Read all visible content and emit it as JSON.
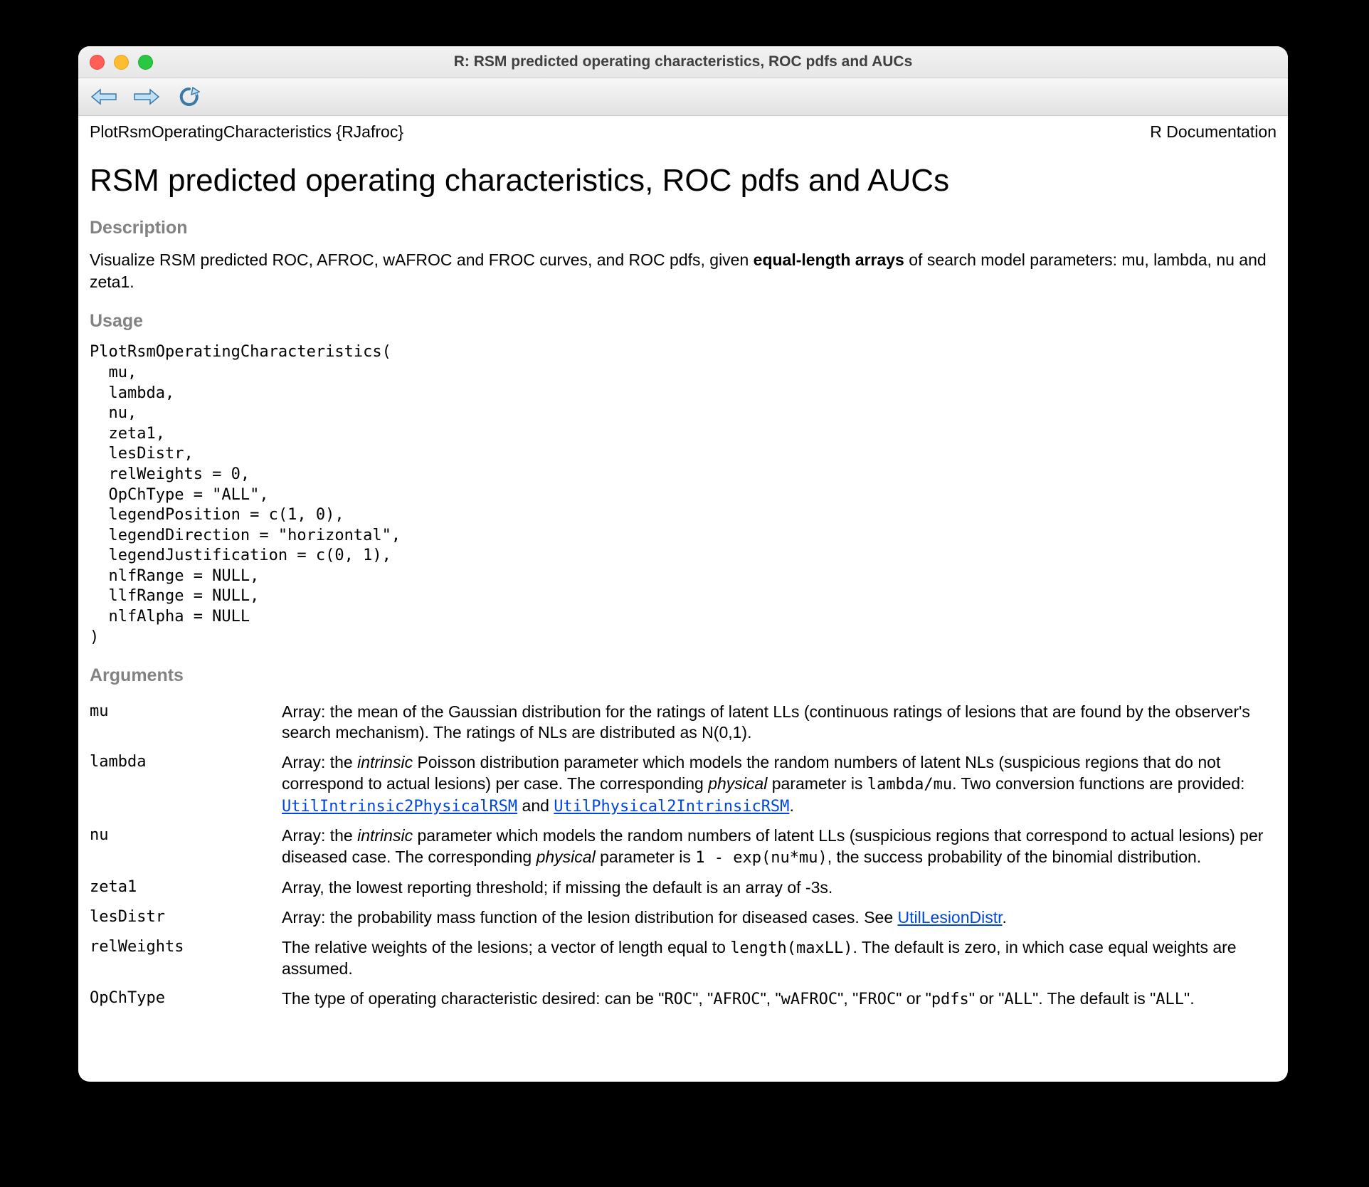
{
  "window": {
    "title": "R: RSM predicted operating characteristics, ROC pdfs and AUCs"
  },
  "header": {
    "func_pkg": "PlotRsmOperatingCharacteristics {RJafroc}",
    "doc_label": "R Documentation"
  },
  "page": {
    "title": "RSM predicted operating characteristics, ROC pdfs and AUCs"
  },
  "sections": {
    "description": "Description",
    "usage": "Usage",
    "arguments": "Arguments"
  },
  "description": {
    "pre": "Visualize RSM predicted ROC, AFROC, wAFROC and FROC curves, and ROC pdfs, given ",
    "bold": "equal-length arrays",
    "post": " of search model parameters: mu, lambda, nu and zeta1."
  },
  "usage_code": "PlotRsmOperatingCharacteristics(\n  mu,\n  lambda,\n  nu,\n  zeta1,\n  lesDistr,\n  relWeights = 0,\n  OpChType = \"ALL\",\n  legendPosition = c(1, 0),\n  legendDirection = \"horizontal\",\n  legendJustification = c(0, 1),\n  nlfRange = NULL,\n  llfRange = NULL,\n  nlfAlpha = NULL\n)",
  "args": {
    "mu": {
      "name": "mu",
      "desc": "Array: the mean of the Gaussian distribution for the ratings of latent LLs (continuous ratings of lesions that are found by the observer's search mechanism). The ratings of NLs are distributed as N(0,1)."
    },
    "lambda": {
      "name": "lambda",
      "pre": "Array: the ",
      "em1": "intrinsic",
      "mid1": " Poisson distribution parameter which models the random numbers of latent NLs (suspicious regions that do not correspond to actual lesions) per case. The corresponding ",
      "em2": "physical",
      "mid2": " parameter is ",
      "code1": "lambda/mu",
      "mid3": ". Two conversion functions are provided: ",
      "link1": "UtilIntrinsic2PhysicalRSM",
      "and": " and ",
      "link2": "UtilPhysical2IntrinsicRSM",
      "end": "."
    },
    "nu": {
      "name": "nu",
      "pre": "Array: the ",
      "em1": "intrinsic",
      "mid1": " parameter which models the random numbers of latent LLs (suspicious regions that correspond to actual lesions) per diseased case. The corresponding ",
      "em2": "physical",
      "mid2": " parameter is ",
      "code1": "1 - exp(nu*mu)",
      "end": ", the success probability of the binomial distribution."
    },
    "zeta1": {
      "name": "zeta1",
      "desc": "Array, the lowest reporting threshold; if missing the default is an array of -3s."
    },
    "lesDistr": {
      "name": "lesDistr",
      "pre": "Array: the probability mass function of the lesion distribution for diseased cases. See ",
      "link": "UtilLesionDistr",
      "end": "."
    },
    "relWeights": {
      "name": "relWeights",
      "pre": "The relative weights of the lesions; a vector of length equal to ",
      "code": "length(maxLL)",
      "end": ". The default is zero, in which case equal weights are assumed."
    },
    "OpChType": {
      "name": "OpChType",
      "pre": "The type of operating characteristic desired: can be \"",
      "c1": "ROC",
      "s1": "\", \"",
      "c2": "AFROC",
      "s2": "\", \"",
      "c3": "wAFROC",
      "s3": "\", \"",
      "c4": "FROC",
      "s4": "\" or \"",
      "c5": "pdfs",
      "s5": "\" or \"",
      "c6": "ALL",
      "s6": "\". The default is \"",
      "c7": "ALL",
      "end": "\"."
    }
  }
}
